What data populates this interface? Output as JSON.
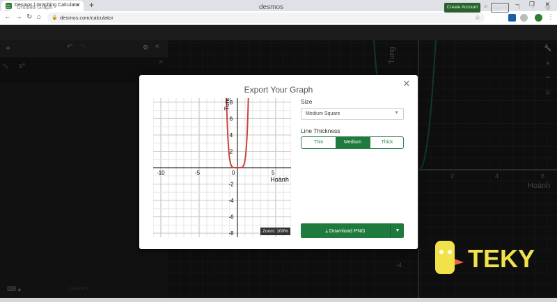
{
  "browser": {
    "tab_title": "Desmos | Graphing Calculator",
    "new_tab": "+",
    "tab_close": "×",
    "url": "desmos.com/calculator",
    "window_controls": "‒ ❐ ✕"
  },
  "header": {
    "graph_title": "Untitled Graph",
    "logo": "desmos",
    "create_account": "Create Account",
    "or": "or",
    "sign_in": "Sign In"
  },
  "expressions": {
    "items": [
      {
        "latex": "x⁶"
      }
    ],
    "powered_by": "desmos"
  },
  "background_graph": {
    "xlabel": "Hoành",
    "ylabel": "Tung",
    "x_ticks": [
      "2",
      "4",
      "6"
    ],
    "y_ticks": [
      "-4"
    ]
  },
  "dialog": {
    "title": "Export Your Graph",
    "size_label": "Size",
    "size_value": "Medium Square",
    "thickness_label": "Line Thickness",
    "thickness_options": [
      "Thin",
      "Medium",
      "Thick"
    ],
    "thickness_selected": "Medium",
    "zoom": "Zoom: 100%",
    "download_label": "Download PNG",
    "colors": {
      "accent": "#1f7a3e",
      "curve": "#c74440"
    }
  },
  "chart_data": {
    "type": "line",
    "function": "y = x^6",
    "xlabel": "Hoành",
    "ylabel": "Tung",
    "xlim": [
      -11,
      7
    ],
    "ylim": [
      -8.5,
      8.5
    ],
    "x_tick_labels": [
      "-10",
      "-5",
      "0",
      "5"
    ],
    "y_tick_labels": [
      "8",
      "6",
      "4",
      "2",
      "-2",
      "-4",
      "-6",
      "-8"
    ],
    "grid": true
  },
  "brand": {
    "name": "TEKY",
    "color": "#f2e24a"
  }
}
